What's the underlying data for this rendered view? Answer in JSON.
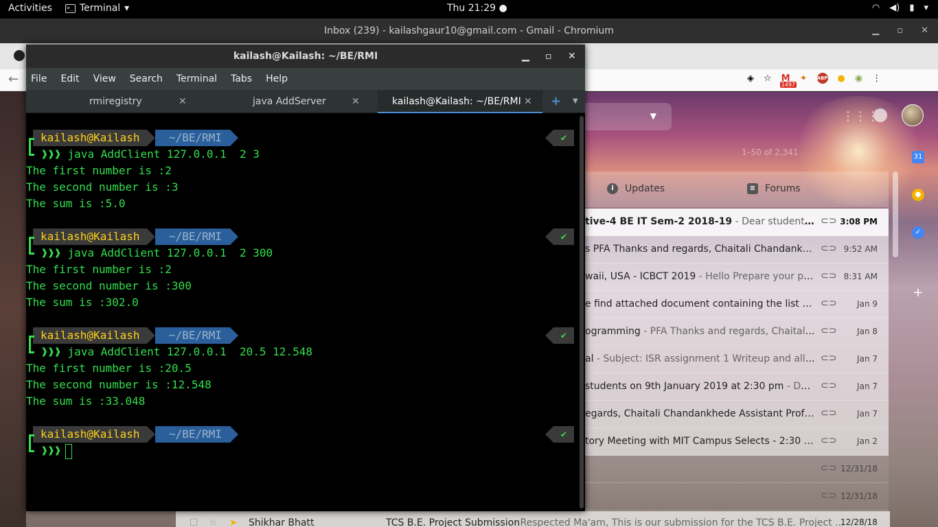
{
  "topbar": {
    "activities": "Activities",
    "app_name": "Terminal",
    "clock": "Thu 21:29",
    "tray_icons": [
      "wifi-icon",
      "volume-icon",
      "battery-icon",
      "power-menu-icon"
    ]
  },
  "chromium": {
    "window_title": "Inbox (239) - kailashgaur10@gmail.com - Gmail - Chromium",
    "gmail_badge": "1497",
    "abp_label": "ABP"
  },
  "gmail": {
    "pager": "1–50 of 2,341",
    "tabs": [
      {
        "label": "Updates",
        "icon": "info-icon"
      },
      {
        "label": "Forums",
        "icon": "forum-icon"
      }
    ],
    "rows": [
      {
        "text": "tive-4 BE IT Sem-2 2018-19",
        "snippet": " - Dear students, Kindl...",
        "date": "3:08 PM",
        "unread": true
      },
      {
        "text": "s PFA Thanks and regards, Chaitali Chandankhede...",
        "snippet": "",
        "date": "9:52 AM",
        "unread": false
      },
      {
        "text": "waii, USA - ICBCT 2019",
        "snippet": " - Hello Prepare your paper a...",
        "date": "8:31 AM",
        "unread": false
      },
      {
        "text": "e find attached document containing the list of st...",
        "snippet": "",
        "date": "Jan 9",
        "unread": false
      },
      {
        "text": "ogramming",
        "snippet": " - PFA Thanks and regards, Chaitali Cha...",
        "date": "Jan 8",
        "unread": false
      },
      {
        "text": "al",
        "snippet": " - Subject: ISR assignment 1 Writeup and all mat...",
        "date": "Jan 7",
        "unread": false
      },
      {
        "text": "students on 9th January 2019 at 2:30 pm",
        "snippet": " - Dear St...",
        "date": "Jan 7",
        "unread": false
      },
      {
        "text": "egards, Chaitali Chandankhede Assistant Professo...",
        "snippet": "",
        "date": "Jan 7",
        "unread": false
      },
      {
        "text": "tory Meeting with MIT Campus Selects - 2:30 pm o...",
        "snippet": "",
        "date": "Jan 2",
        "unread": false
      },
      {
        "text": "",
        "snippet": "",
        "date": "12/31/18",
        "unread": false
      },
      {
        "text": "",
        "snippet": "",
        "date": "12/31/18",
        "unread": false
      }
    ],
    "bottom_row": {
      "sender": "Shikhar Bhatt",
      "subject": "TCS B.E. Project Submission",
      "snippet": " - Respected Ma'am, This is our submission for the TCS B.E. Project ...",
      "date": "12/28/18"
    },
    "rail_calendar": "31"
  },
  "terminal": {
    "title": "kailash@Kailash: ~/BE/RMI",
    "menu": [
      "File",
      "Edit",
      "View",
      "Search",
      "Terminal",
      "Tabs",
      "Help"
    ],
    "tabs": [
      {
        "label": "rmiregistry",
        "active": false
      },
      {
        "label": "java AddServer",
        "active": false
      },
      {
        "label": "kailash@Kailash: ~/BE/RMI",
        "active": true
      }
    ],
    "prompt_user": "kailash@Kailash",
    "prompt_path": "~/BE/RMI",
    "prompt_arrows": "❱❱❱",
    "status_mark": "✔",
    "blocks": [
      {
        "command": "java AddClient 127.0.0.1  2 3",
        "output": [
          "The first number is :2",
          "The second number is :3",
          "The sum is :5.0"
        ]
      },
      {
        "command": "java AddClient 127.0.0.1  2 300",
        "output": [
          "The first number is :2",
          "The second number is :300",
          "The sum is :302.0"
        ]
      },
      {
        "command": "java AddClient 127.0.0.1  20.5 12.548",
        "output": [
          "The first number is :20.5",
          "The second number is :12.548",
          "The sum is :33.048"
        ]
      }
    ]
  },
  "colors": {
    "terminal_green": "#33e04d",
    "prompt_user_fg": "#ffd11a",
    "prompt_path_bg": "#2b5f9b",
    "tab_accent": "#4a90d9"
  }
}
